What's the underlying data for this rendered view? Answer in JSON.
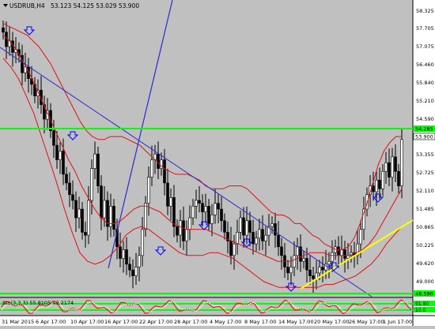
{
  "header": {
    "symbol": "USDRUB,H4",
    "ohlc": "53.123 54.125 53.029 53.900"
  },
  "price_axis": {
    "labels": [
      "58.325",
      "57.705",
      "57.075",
      "56.460",
      "55.840",
      "55.210",
      "54.590",
      "53.355",
      "52.725",
      "52.110",
      "51.485",
      "50.865",
      "50.225",
      "49.620",
      "49.000"
    ],
    "highlight_top": "54.285",
    "current_price": "53.900",
    "highlight_bottom": "48.590"
  },
  "indicator": {
    "label": "Sto(3,3,3) 55.8105 49.2174",
    "levels": [
      "91.80",
      "10.0"
    ]
  },
  "time_axis": {
    "labels": [
      "31 Mar 2015",
      "6 Apr 17:00",
      "10 Apr 17:00",
      "16 Apr 17:00",
      "22 Apr 17:00",
      "28 Apr 17:00",
      "4 May 17:00",
      "8 May 17:00",
      "14 May 17:00",
      "20 May 17:00",
      "26 May 17:00",
      "1 Jun 17:00"
    ]
  },
  "colors": {
    "background": "#c0c0c0",
    "axis_panel": "#ffffff",
    "candles": "#000000",
    "bollinger": "#ff0000",
    "trendline": "#0000cc",
    "support_line": "#ffff00",
    "horizontal_level": "#00ff00",
    "arrow": "#0000ff"
  },
  "chart_data": {
    "type": "candlestick",
    "symbol": "USDRUB",
    "timeframe": "H4",
    "ylim": [
      48.59,
      58.6
    ],
    "closes": [
      57.6,
      57.1,
      57.3,
      56.9,
      57.0,
      56.8,
      56.2,
      56.4,
      56.0,
      55.8,
      55.4,
      55.6,
      55.1,
      54.6,
      54.9,
      54.2,
      53.7,
      53.2,
      53.5,
      52.7,
      52.4,
      52.0,
      51.8,
      51.2,
      51.5,
      50.7,
      50.6,
      51.8,
      52.9,
      53.4,
      52.3,
      51.2,
      51.8,
      50.9,
      51.6,
      50.8,
      50.2,
      49.8,
      50.1,
      49.6,
      49.4,
      49.2,
      49.5,
      49.9,
      50.8,
      51.7,
      52.6,
      53.2,
      53.4,
      52.9,
      53.2,
      52.4,
      51.6,
      51.9,
      50.9,
      50.6,
      51.1,
      50.4,
      50.8,
      51.2,
      51.6,
      51.8,
      51.7,
      51.4,
      51.6,
      51.0,
      51.3,
      51.7,
      51.5,
      51.1,
      50.7,
      50.4,
      49.9,
      50.3,
      50.7,
      51.2,
      50.6,
      51.1,
      50.7,
      50.3,
      50.5,
      50.8,
      50.4,
      50.6,
      50.9,
      51.0,
      50.6,
      50.2,
      49.9,
      49.5,
      49.3,
      49.5,
      49.9,
      50.2,
      49.7,
      49.8,
      49.4,
      49.2,
      49.1,
      49.3,
      49.5,
      49.4,
      49.6,
      49.7,
      50.0,
      50.2,
      49.9,
      50.1,
      49.8,
      49.9,
      50.0,
      49.9,
      50.3,
      50.8,
      51.5,
      52.0,
      52.3,
      52.1,
      52.5,
      52.2,
      52.8,
      53.1,
      52.6,
      53.3,
      52.8,
      52.3,
      53.9
    ],
    "bollinger_upper": [
      57.9,
      57.8,
      57.7,
      57.6,
      57.5,
      57.3,
      57.1,
      56.8,
      56.5,
      56.1,
      55.7,
      55.3,
      54.9,
      54.5,
      54.2,
      54.0,
      53.9,
      53.9,
      54.0,
      54.0,
      54.0,
      53.9,
      53.8,
      53.7,
      53.5,
      53.3,
      53.1,
      52.9,
      52.8,
      52.7,
      52.7,
      52.7,
      52.6,
      52.5,
      52.3,
      52.2,
      52.2,
      52.2,
      52.3,
      52.3,
      52.3,
      52.2,
      52.0,
      51.8,
      51.6,
      51.4,
      51.3,
      51.3,
      51.2,
      51.0,
      51.0,
      50.8,
      50.6,
      50.5,
      50.3,
      50.2,
      50.1,
      50.1,
      50.2,
      50.5,
      51.0,
      51.6,
      52.3,
      53.0,
      53.5,
      53.8,
      54.0,
      54.0
    ],
    "bollinger_middle": [
      57.5,
      57.3,
      57.0,
      56.6,
      56.2,
      55.7,
      55.2,
      54.7,
      54.2,
      53.7,
      53.2,
      52.8,
      52.3,
      51.9,
      51.5,
      51.2,
      51.0,
      51.0,
      51.1,
      51.3,
      51.5,
      51.6,
      51.6,
      51.5,
      51.4,
      51.2,
      51.0,
      50.9,
      50.8,
      50.8,
      50.8,
      50.8,
      50.7,
      50.6,
      50.5,
      50.4,
      50.3,
      50.2,
      50.1,
      50.0,
      49.9,
      49.8,
      49.7,
      49.7,
      49.7,
      49.8,
      49.9,
      50.0,
      50.0,
      50.0,
      49.9,
      49.9,
      49.9,
      49.9,
      50.0,
      50.1,
      50.3,
      50.6,
      51.0,
      51.4,
      51.8,
      52.2
    ],
    "bollinger_lower": [
      56.7,
      56.4,
      56.0,
      55.4,
      54.8,
      54.0,
      53.2,
      52.4,
      51.5,
      50.7,
      50.0,
      49.7,
      49.6,
      49.7,
      49.9,
      50.2,
      50.6,
      50.8,
      50.9,
      50.8,
      50.6,
      50.4,
      50.2,
      50.0,
      49.9,
      49.9,
      49.9,
      50.0,
      50.0,
      49.9,
      49.8,
      49.6,
      49.4,
      49.2,
      49.0,
      48.9,
      48.8,
      48.8,
      48.8,
      48.8,
      48.8,
      48.8,
      48.9,
      48.9,
      49.0,
      49.1,
      49.2,
      49.4,
      49.6,
      49.9,
      50.3,
      50.6,
      50.9
    ],
    "price_levels": [
      54.285,
      48.59
    ]
  }
}
